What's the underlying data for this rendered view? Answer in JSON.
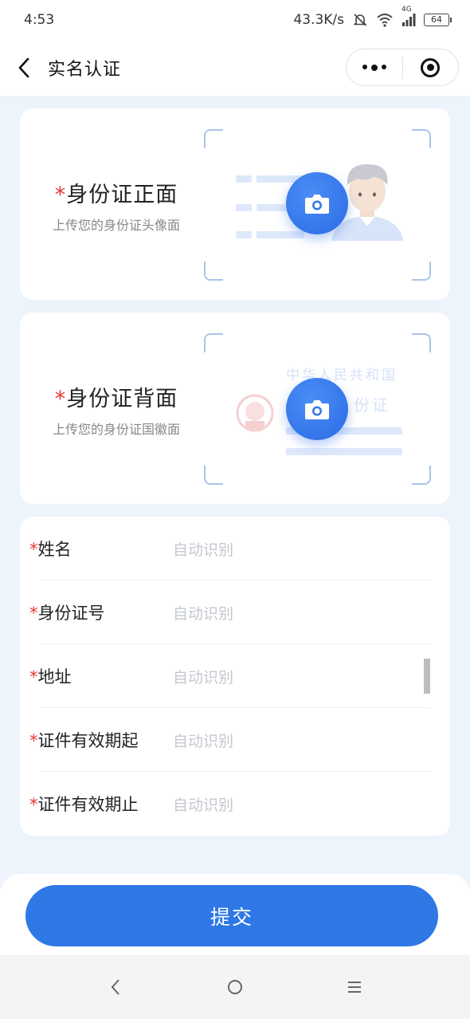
{
  "status_bar": {
    "time": "4:53",
    "speed": "43.3K/s",
    "network": "4G",
    "battery": "64"
  },
  "nav": {
    "title": "实名认证"
  },
  "id_front": {
    "star": "*",
    "title": "身份证正面",
    "subtitle": "上传您的身份证头像面"
  },
  "id_back": {
    "star": "*",
    "title": "身份证背面",
    "subtitle": "上传您的身份证国徽面",
    "emblem_line1": "中华人民共和国",
    "emblem_line2": "份证"
  },
  "form": {
    "rows": [
      {
        "star": "*",
        "label": "姓名",
        "value": "自动识别"
      },
      {
        "star": "*",
        "label": "身份证号",
        "value": "自动识别"
      },
      {
        "star": "*",
        "label": "地址",
        "value": "自动识别"
      },
      {
        "star": "*",
        "label": "证件有效期起",
        "value": "自动识别"
      },
      {
        "star": "*",
        "label": "证件有效期止",
        "value": "自动识别"
      }
    ]
  },
  "submit": {
    "label": "提交"
  },
  "colors": {
    "accent": "#2f78e6",
    "required": "#e53935",
    "placeholder": "#c4c8cf"
  },
  "icons": [
    "back-arrow-icon",
    "more-dots-icon",
    "target-icon",
    "camera-icon",
    "wifi-icon",
    "mute-icon",
    "signal-icon"
  ]
}
